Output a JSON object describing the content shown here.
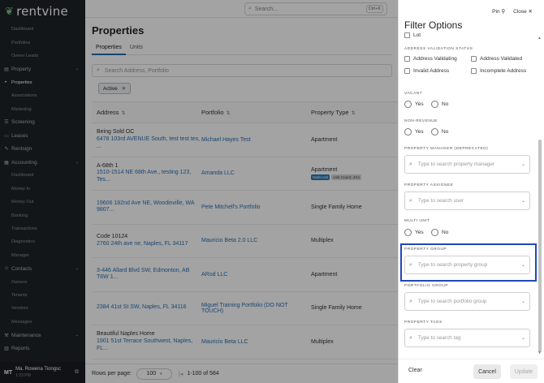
{
  "app": {
    "name": "rentvine"
  },
  "sidebar": {
    "items": [
      {
        "label": "Dashboard",
        "type": "sub"
      },
      {
        "label": "Portfolios",
        "type": "sub"
      },
      {
        "label": "Owner Leads",
        "type": "sub"
      },
      {
        "label": "Property",
        "type": "section",
        "icon": "building-icon"
      },
      {
        "label": "Properties",
        "type": "sub",
        "active": true
      },
      {
        "label": "Associations",
        "type": "sub"
      },
      {
        "label": "Marketing",
        "type": "sub"
      },
      {
        "label": "Screening",
        "type": "section",
        "icon": "screening-icon"
      },
      {
        "label": "Leases",
        "type": "section",
        "icon": "lease-icon"
      },
      {
        "label": "Rentsign",
        "type": "section",
        "icon": "pen-icon"
      },
      {
        "label": "Accounting",
        "type": "section",
        "icon": "accounting-icon"
      },
      {
        "label": "Dashboard",
        "type": "sub"
      },
      {
        "label": "Money In",
        "type": "sub"
      },
      {
        "label": "Money Out",
        "type": "sub"
      },
      {
        "label": "Banking",
        "type": "sub"
      },
      {
        "label": "Transactions",
        "type": "sub"
      },
      {
        "label": "Diagnostics",
        "type": "sub"
      },
      {
        "label": "Manager",
        "type": "sub"
      },
      {
        "label": "Contacts",
        "type": "section",
        "icon": "contacts-icon"
      },
      {
        "label": "Owners",
        "type": "sub"
      },
      {
        "label": "Tenants",
        "type": "sub"
      },
      {
        "label": "Vendors",
        "type": "sub"
      },
      {
        "label": "Messages",
        "type": "sub"
      },
      {
        "label": "Maintenance",
        "type": "section",
        "icon": "wrench-icon"
      },
      {
        "label": "Reports",
        "type": "section",
        "icon": "reports-icon"
      }
    ],
    "user": {
      "initials": "MT",
      "name": "Ma. Rowena Tiongsc",
      "time": "1:23 PM"
    }
  },
  "topbar": {
    "search_placeholder": "Search...",
    "shortcut": "Ctrl+K"
  },
  "main": {
    "title": "Properties",
    "tabs": [
      {
        "label": "Properties",
        "active": true
      },
      {
        "label": "Units",
        "active": false
      }
    ],
    "search_placeholder": "Search Address, Portfolio",
    "chip": "Active",
    "columns": {
      "address": "Address",
      "portfolio": "Portfolio",
      "type": "Property Type"
    },
    "rows": [
      {
        "name": "Being Sold OC",
        "address": "6478 103rd AVENUE South, test test tes, ...",
        "portfolio": "Michael Hayes Test",
        "type": "Apartment"
      },
      {
        "name": "A-68th 1",
        "address": "1510-1514 NE 68th Ave., testing 123, Tes...",
        "portfolio": "Amanda LLC",
        "type": "Apartment",
        "badges": [
          "Multi-Unit",
          "Unit Count: 4/11"
        ]
      },
      {
        "name": "",
        "address": "19606 182nd Ave NE, Woodinville, WA 9807...",
        "portfolio": "Pete Mitchell's Portfolio",
        "type": "Single Family Home"
      },
      {
        "name": "Code 10124",
        "address": "2760 24th ave ne, Naples, FL 34117",
        "portfolio": "Mauricio Beta 2.0 LLC",
        "type": "Multiplex"
      },
      {
        "name": "",
        "address": "3-446 Allard Blvd SW, Edmonton, AB T6W 1...",
        "portfolio": "ARod LLC",
        "type": "Apartment"
      },
      {
        "name": "",
        "address": "2384 41st St SW, Naples, FL 34116",
        "portfolio": "Miguel Training Portfolio (DO NOT TOUCH)",
        "type": "Single Family Home"
      },
      {
        "name": "Beautiful Naples Home",
        "address": "1901 51st Terrace Southwest, Naples, FL...",
        "portfolio": "Mauricio Beta LLC",
        "type": "Multiplex"
      }
    ],
    "footer": {
      "rows_per_page_label": "Rows per page:",
      "rows_per_page": "100",
      "range": "1-100 of 584"
    }
  },
  "panel": {
    "title": "Filter Options",
    "pin": "Pin",
    "close": "Close",
    "top_cut": "Lot",
    "sections": {
      "address_validation": {
        "label": "ADDRESS VALIDATION STATUS",
        "options": [
          "Address Validating",
          "Address Validated",
          "Invalid Address",
          "Incomplete Address"
        ]
      },
      "vacant": {
        "label": "VACANT",
        "yes": "Yes",
        "no": "No"
      },
      "non_revenue": {
        "label": "NON-REVENUE",
        "yes": "Yes",
        "no": "No"
      },
      "property_manager": {
        "label": "PROPERTY MANAGER (DEPRECATED)",
        "placeholder": "Type to search property manager"
      },
      "property_assignee": {
        "label": "PROPERTY ASSIGNEE",
        "placeholder": "Type to search user"
      },
      "multi_unit": {
        "label": "MULTI UNIT",
        "yes": "Yes",
        "no": "No"
      },
      "property_group": {
        "label": "PROPERTY GROUP",
        "placeholder": "Type to search property group"
      },
      "portfolio_group": {
        "label": "PORTFOLIO GROUP",
        "placeholder": "Type to search portfolio group"
      },
      "property_tags": {
        "label": "PROPERTY TAGS",
        "placeholder": "Type to search tag"
      }
    },
    "footer": {
      "clear": "Clear",
      "cancel": "Cancel",
      "update": "Update"
    }
  },
  "colors": {
    "accent": "#2b6fb3",
    "highlight": "#1f49b6"
  }
}
